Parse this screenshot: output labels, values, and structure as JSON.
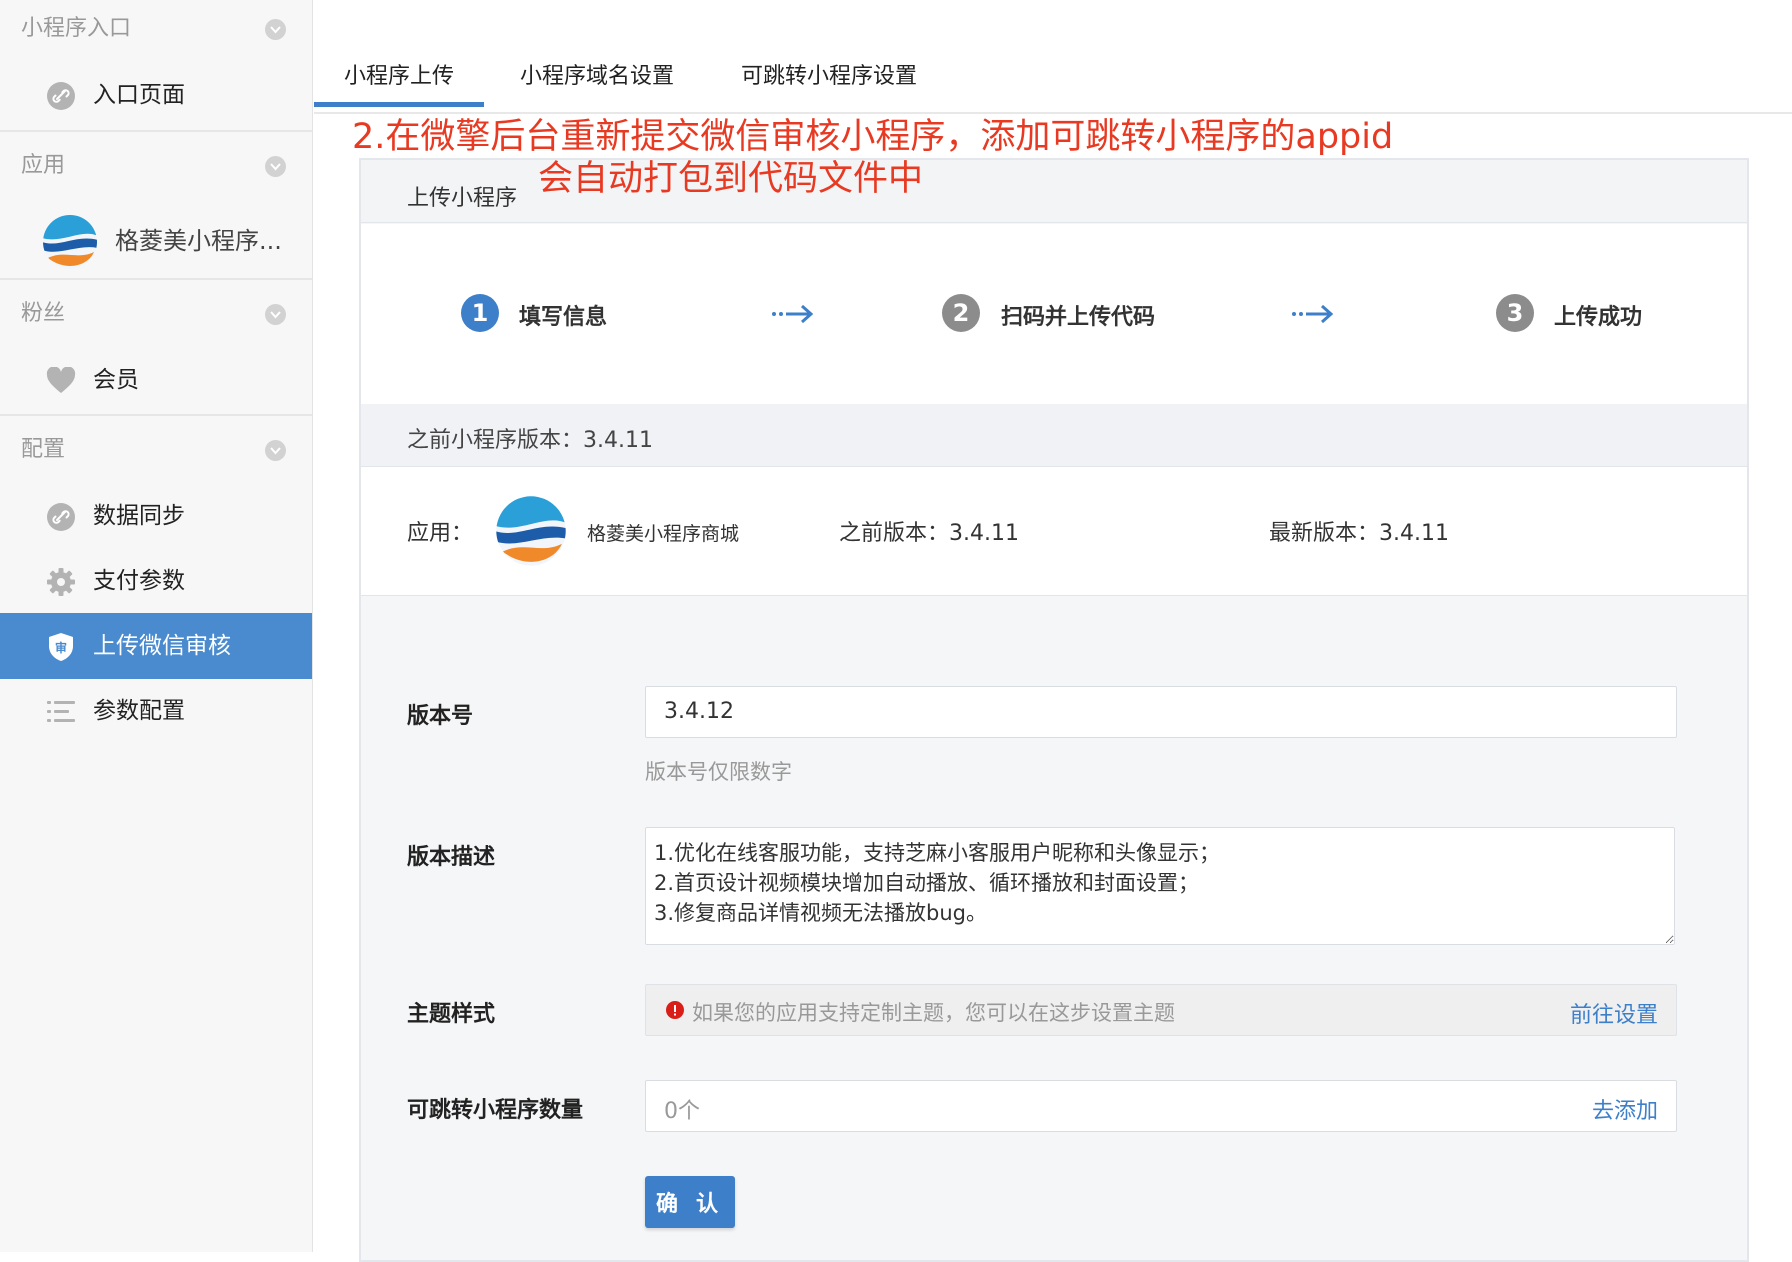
{
  "sidebar": {
    "sections": [
      {
        "title": "小程序入口",
        "items": [
          {
            "label": "入口页面",
            "icon": "link-icon"
          }
        ]
      },
      {
        "title": "应用",
        "items": [
          {
            "label": "格菱美小程序...",
            "icon": "app-logo"
          }
        ]
      },
      {
        "title": "粉丝",
        "items": [
          {
            "label": "会员",
            "icon": "heart-icon"
          }
        ]
      },
      {
        "title": "配置",
        "items": [
          {
            "label": "数据同步",
            "icon": "link-icon"
          },
          {
            "label": "支付参数",
            "icon": "gear-icon"
          },
          {
            "label": "上传微信审核",
            "icon": "shield-icon",
            "active": true
          },
          {
            "label": "参数配置",
            "icon": "list-icon"
          }
        ]
      }
    ],
    "active_color": "#4a8bcf"
  },
  "tabs": [
    {
      "label": "小程序上传",
      "active": true
    },
    {
      "label": "小程序域名设置"
    },
    {
      "label": "可跳转小程序设置"
    }
  ],
  "annotation": {
    "line1": "2.在微擎后台重新提交微信审核小程序，添加可跳转小程序的appid",
    "line2": "会自动打包到代码文件中",
    "color": "#e83a22"
  },
  "panel": {
    "title": "上传小程序",
    "steps": [
      {
        "num": "1",
        "label": "填写信息",
        "color": "#3d7fc9"
      },
      {
        "num": "2",
        "label": "扫码并上传代码",
        "color": "#8c8c8c"
      },
      {
        "num": "3",
        "label": "上传成功",
        "color": "#8c8c8c"
      }
    ],
    "prev_version_bar": "之前小程序版本：3.4.11",
    "app_info": {
      "app_label": "应用：",
      "app_name": "格菱美小程序商城",
      "prev_version": "之前版本：3.4.11",
      "latest_version": "最新版本：3.4.11"
    },
    "form": {
      "version_label": "版本号",
      "version_value": "3.4.12",
      "version_hint": "版本号仅限数字",
      "desc_label": "版本描述",
      "desc_value": "1.优化在线客服功能，支持芝麻小客服用户昵称和头像显示；\n2.首页设计视频模块增加自动播放、循环播放和封面设置；\n3.修复商品详情视频无法播放bug。",
      "theme_label": "主题样式",
      "theme_notice": "如果您的应用支持定制主题，您可以在这步设置主题",
      "theme_link": "前往设置",
      "jump_label": "可跳转小程序数量",
      "jump_value": "0个",
      "jump_link": "去添加",
      "confirm": "确 认"
    }
  }
}
